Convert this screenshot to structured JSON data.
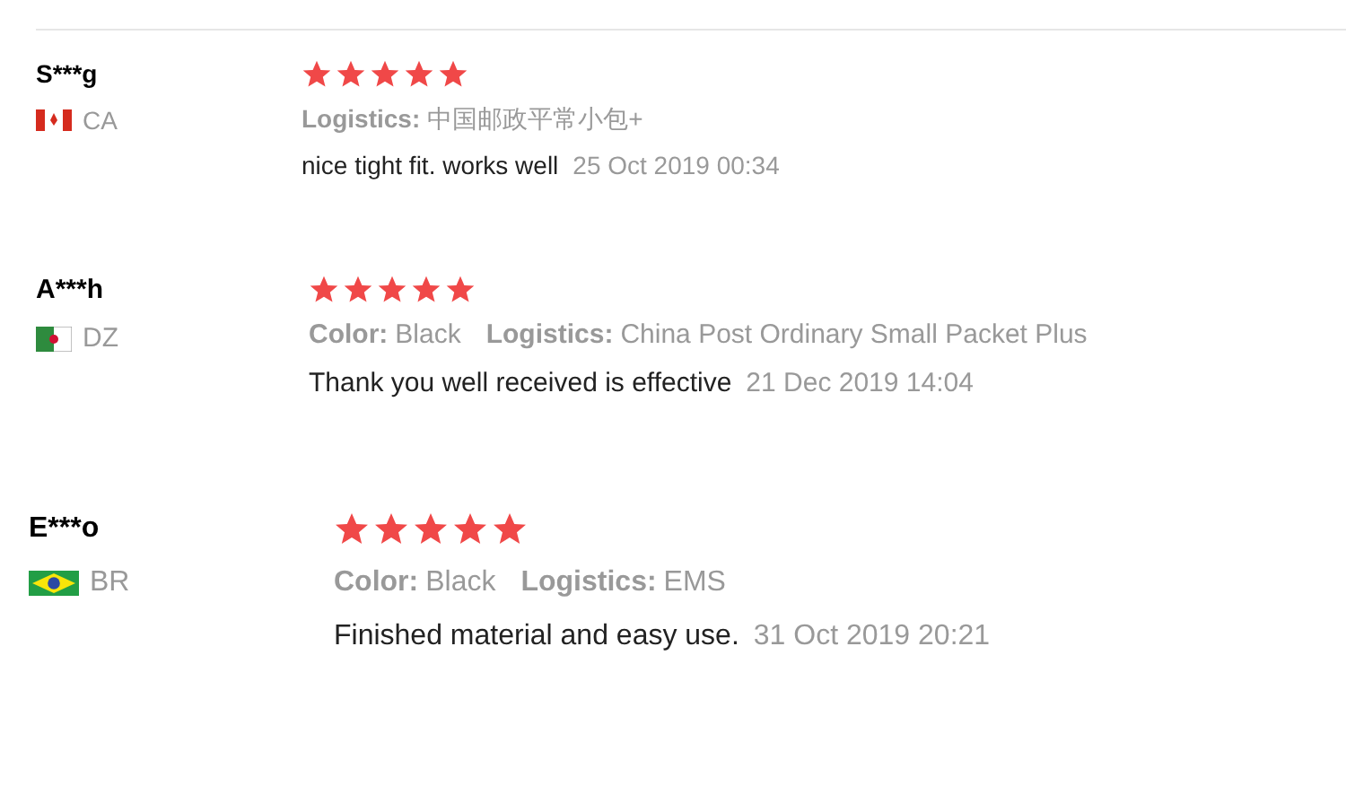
{
  "reviews": [
    {
      "user": "S***g",
      "kind": "ca",
      "country": "CA",
      "stars": 5,
      "attributes": [
        {
          "label": "Logistics:",
          "value": "中国邮政平常小包+"
        }
      ],
      "text": "nice tight fit. works well",
      "date": "25 Oct 2019 00:34"
    },
    {
      "user": "A***h",
      "kind": "dz",
      "country": "DZ",
      "stars": 5,
      "attributes": [
        {
          "label": "Color:",
          "value": "Black"
        },
        {
          "label": "Logistics:",
          "value": "China Post Ordinary Small Packet Plus"
        }
      ],
      "text": "Thank you well received is effective",
      "date": "21 Dec 2019 14:04"
    },
    {
      "user": "E***o",
      "kind": "br",
      "country": "BR",
      "stars": 5,
      "attributes": [
        {
          "label": "Color:",
          "value": "Black"
        },
        {
          "label": "Logistics:",
          "value": "EMS"
        }
      ],
      "text": "Finished material and easy use.",
      "date": "31 Oct 2019 20:21"
    }
  ]
}
